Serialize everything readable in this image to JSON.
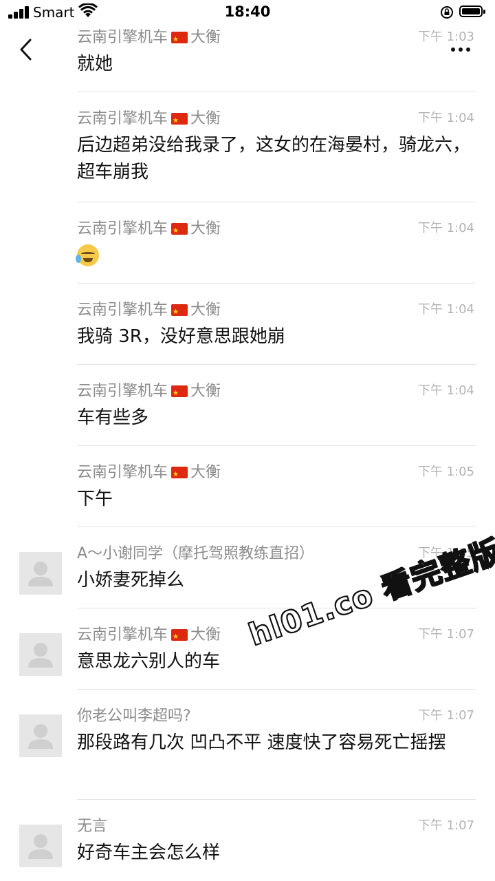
{
  "status_bar": {
    "carrier": "Smart",
    "time": "18:40"
  },
  "nav": {
    "back_icon": "chevron-left-icon",
    "more_icon": "more-dots-icon"
  },
  "messages": [
    {
      "name": "云南引擎机车",
      "name_suffix": "大衡",
      "flag": true,
      "time": "下午 1:03",
      "text": "就她",
      "avatar": false
    },
    {
      "name": "云南引擎机车",
      "name_suffix": "大衡",
      "flag": true,
      "time": "下午 1:04",
      "text": "后边超弟没给我录了，这女的在海晏村，骑龙六，超车崩我",
      "avatar": false
    },
    {
      "name": "云南引擎机车",
      "name_suffix": "大衡",
      "flag": true,
      "time": "下午 1:04",
      "text": "",
      "emoji": "crying-laughing-emoji",
      "avatar": false
    },
    {
      "name": "云南引擎机车",
      "name_suffix": "大衡",
      "flag": true,
      "time": "下午 1:04",
      "text": "我骑 3R，没好意思跟她崩",
      "avatar": false
    },
    {
      "name": "云南引擎机车",
      "name_suffix": "大衡",
      "flag": true,
      "time": "下午 1:04",
      "text": "车有些多",
      "avatar": false
    },
    {
      "name": "云南引擎机车",
      "name_suffix": "大衡",
      "flag": true,
      "time": "下午 1:05",
      "text": "下午",
      "avatar": false
    },
    {
      "name": "A～小谢同学（摩托驾照教练直招）",
      "name_suffix": "",
      "flag": false,
      "time": "下午 1:05",
      "text": "小娇妻死掉么",
      "avatar": true
    },
    {
      "name": "云南引擎机车",
      "name_suffix": "大衡",
      "flag": true,
      "time": "下午 1:07",
      "text": "意思龙六别人的车",
      "avatar": true
    },
    {
      "name": "你老公叫李超吗?",
      "name_suffix": "",
      "flag": false,
      "time": "下午 1:07",
      "text": "那段路有几次 凹凸不平 速度快了容易死亡摇摆",
      "avatar": true
    },
    {
      "name": "无言",
      "name_suffix": "",
      "flag": false,
      "time": "下午 1:07",
      "text": "好奇车主会怎么样",
      "avatar": true
    }
  ],
  "watermark": "hl01.co 看完整版"
}
